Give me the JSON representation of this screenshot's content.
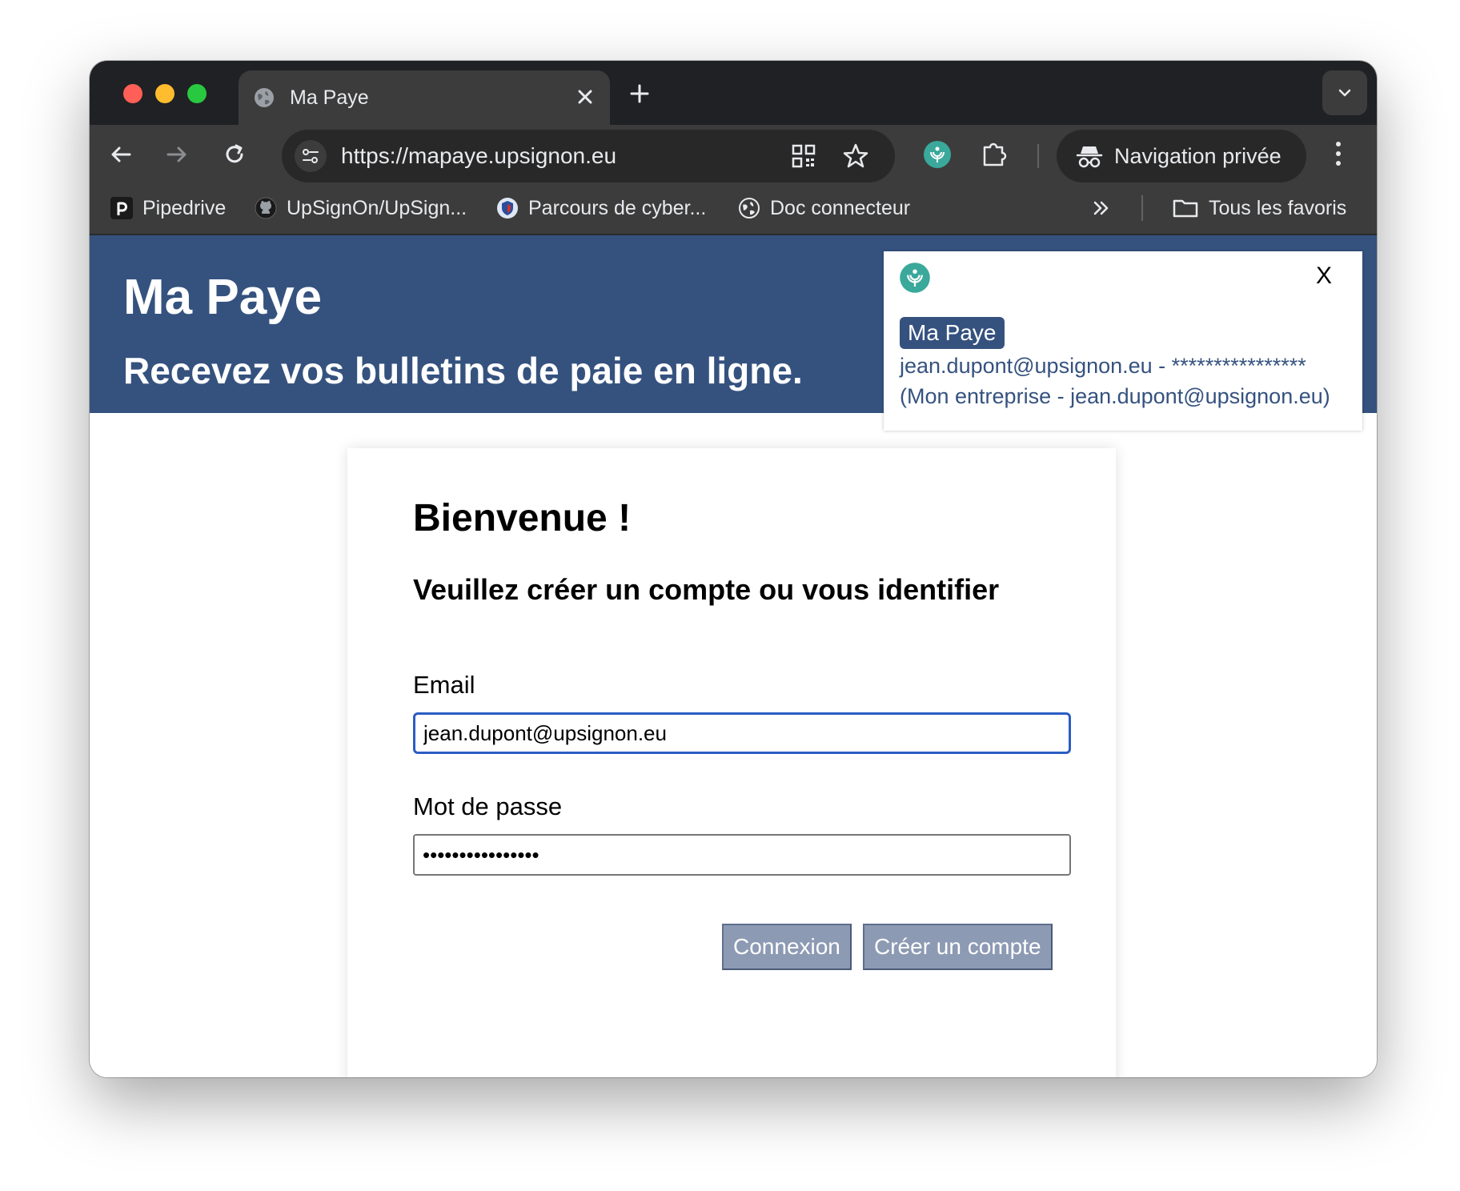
{
  "browser": {
    "tab_title": "Ma Paye",
    "url": "https://mapaye.upsignon.eu",
    "incognito_label": "Navigation privée",
    "bookmarks": [
      {
        "label": "Pipedrive",
        "icon": "pipedrive-icon"
      },
      {
        "label": "UpSignOn/UpSign...",
        "icon": "github-icon"
      },
      {
        "label": "Parcours de cyber...",
        "icon": "shield-badge-icon"
      },
      {
        "label": "Doc connecteur",
        "icon": "globe-icon"
      }
    ],
    "all_bookmarks_label": "Tous les favoris"
  },
  "header": {
    "title": "Ma Paye",
    "tagline": "Recevez vos bulletins de paie en ligne."
  },
  "upsignon_popup": {
    "close_label": "X",
    "account_name": "Ma Paye",
    "login_line": "jean.dupont@upsignon.eu - ****************",
    "detail_line": "(Mon entreprise - jean.dupont@upsignon.eu)"
  },
  "login": {
    "heading": "Bienvenue !",
    "subheading": "Veuillez créer un compte ou vous identifier",
    "email_label": "Email",
    "email_value": "jean.dupont@upsignon.eu",
    "password_label": "Mot de passe",
    "password_value": "****************",
    "login_button": "Connexion",
    "signup_button": "Créer un compte"
  },
  "colors": {
    "banner": "#35527f",
    "button": "#8d9ab3",
    "focus_ring": "#2b5cc4",
    "upsignon_teal": "#3aa89a"
  }
}
